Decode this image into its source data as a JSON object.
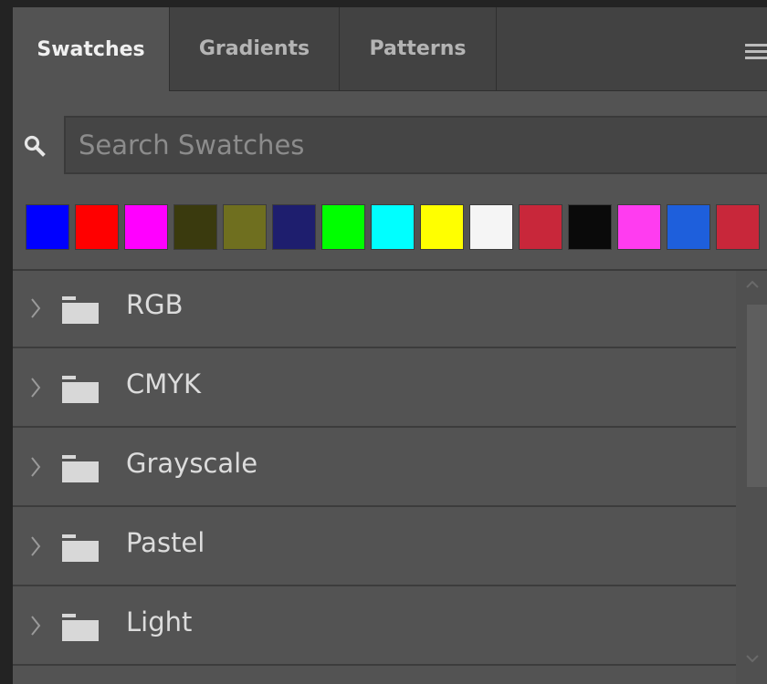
{
  "tabs": [
    {
      "label": "Swatches",
      "active": true
    },
    {
      "label": "Gradients",
      "active": false
    },
    {
      "label": "Patterns",
      "active": false
    }
  ],
  "panel_menu_icon": "hamburger-menu-icon",
  "search": {
    "placeholder": "Search Swatches",
    "value": "",
    "icon": "search-icon"
  },
  "recent_swatches": [
    "#0000ff",
    "#ff0000",
    "#ff00ff",
    "#3a3a0e",
    "#6f6f1f",
    "#1e1e6e",
    "#00ff00",
    "#00ffff",
    "#ffff00",
    "#f5f5f5",
    "#c8273a",
    "#0a0a0a",
    "#ff3cf0",
    "#1e5fdc",
    "#c8273a"
  ],
  "groups": [
    {
      "label": "RGB"
    },
    {
      "label": "CMYK"
    },
    {
      "label": "Grayscale"
    },
    {
      "label": "Pastel"
    },
    {
      "label": "Light"
    }
  ],
  "colors": {
    "panel_bg": "#535353",
    "tab_bar_bg": "#424242",
    "text": "#dcdcdc"
  }
}
